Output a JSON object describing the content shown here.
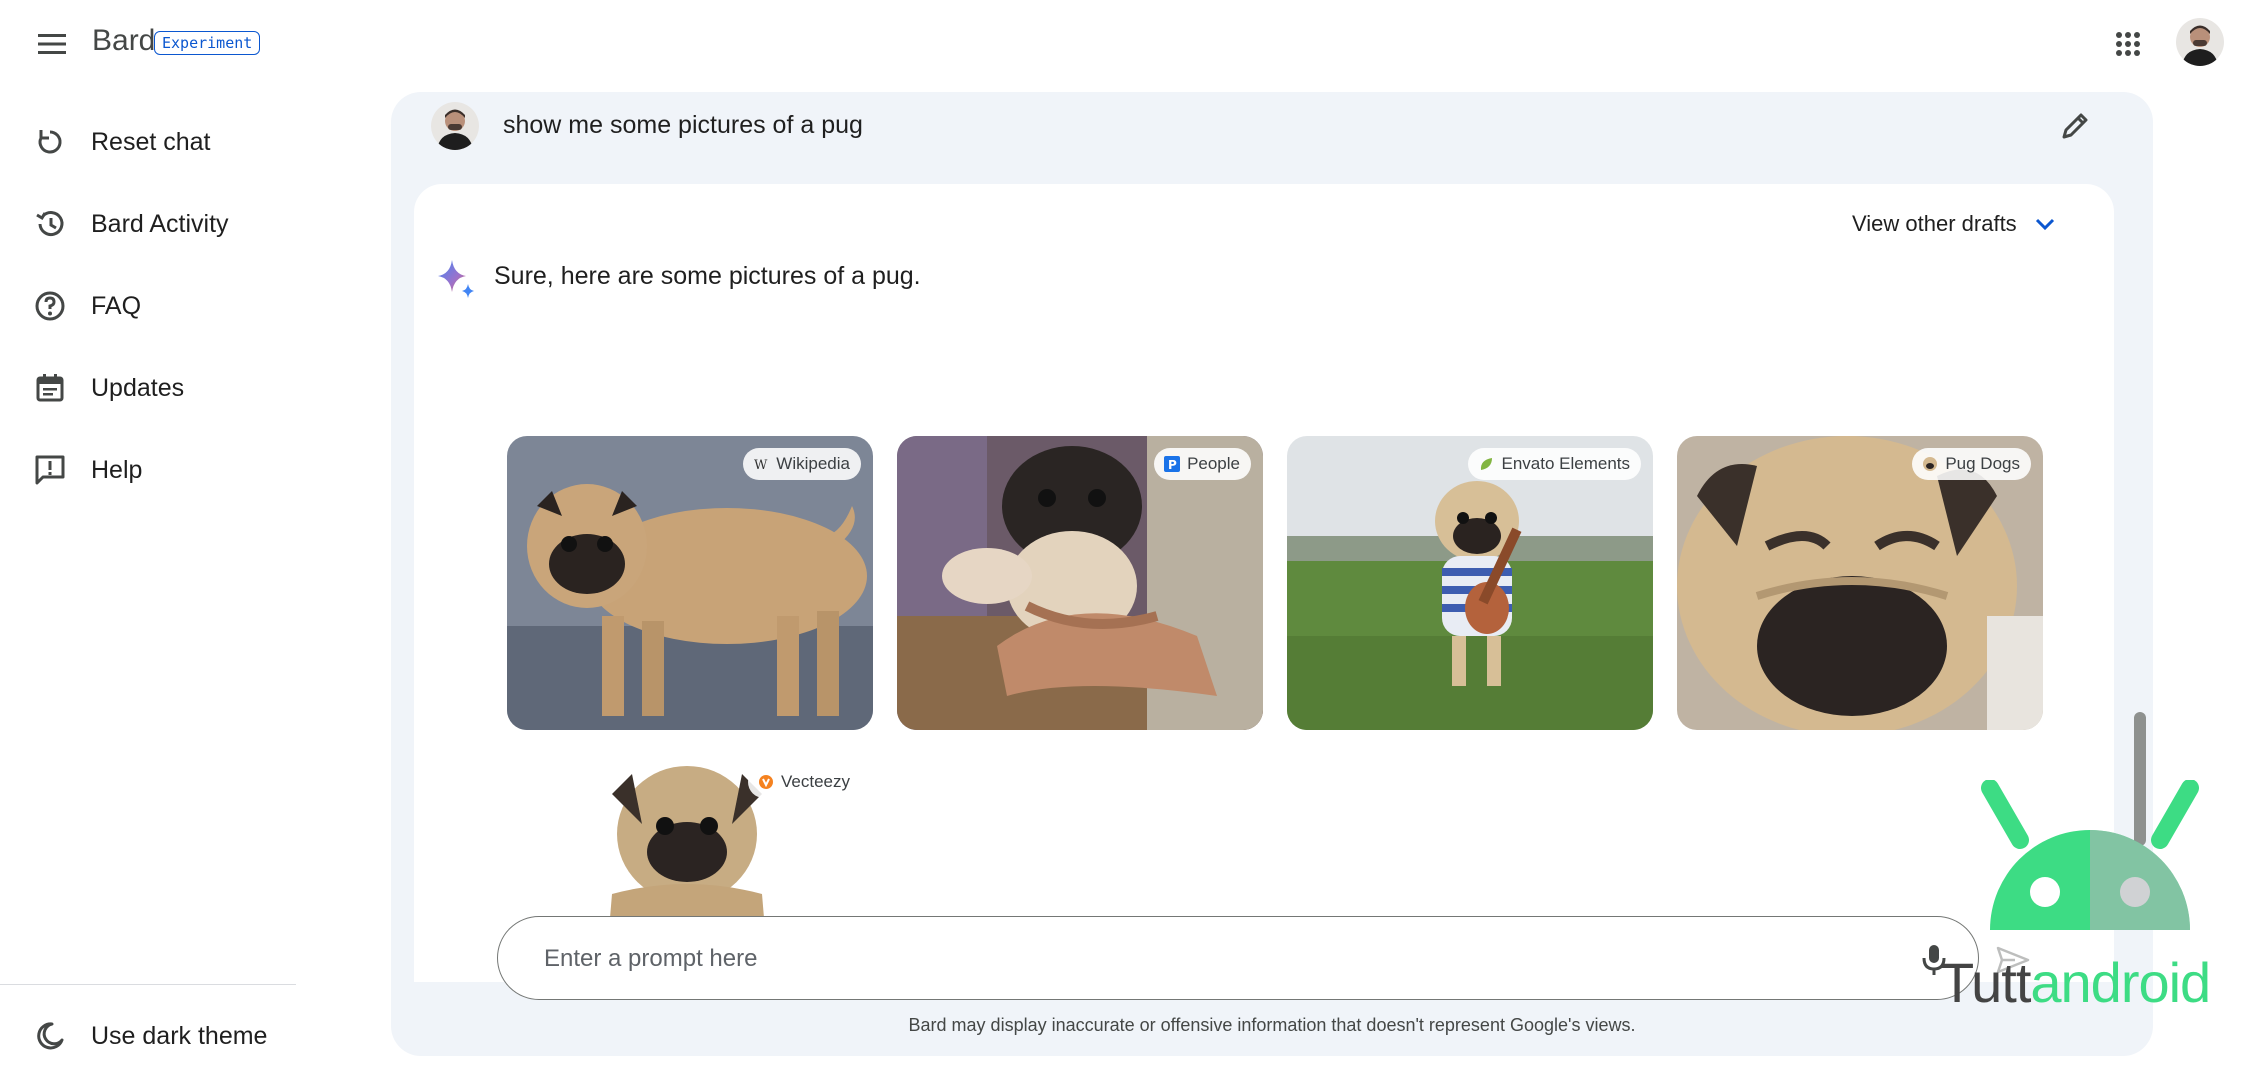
{
  "app": {
    "name": "Bard",
    "badge": "Experiment"
  },
  "header": {
    "menu_icon": "hamburger-menu-icon",
    "apps_icon": "apps-grid-icon"
  },
  "sidebar": {
    "items": [
      {
        "label": "Reset chat",
        "icon": "reset-icon"
      },
      {
        "label": "Bard Activity",
        "icon": "history-icon"
      },
      {
        "label": "FAQ",
        "icon": "help-circle-icon"
      },
      {
        "label": "Updates",
        "icon": "calendar-icon"
      },
      {
        "label": "Help",
        "icon": "feedback-icon"
      }
    ],
    "footer": {
      "label": "Use dark theme",
      "icon": "moon-icon"
    }
  },
  "conversation": {
    "user_query": "show me some pictures of a pug",
    "drafts_label": "View other drafts",
    "response_text": "Sure, here are some pictures of a pug.",
    "images": [
      {
        "source": "Wikipedia"
      },
      {
        "source": "People"
      },
      {
        "source": "Envato Elements"
      },
      {
        "source": "Pug Dogs"
      },
      {
        "source": "Vecteezy"
      }
    ]
  },
  "input": {
    "placeholder": "Enter a prompt here",
    "value": ""
  },
  "disclaimer": "Bard may display inaccurate or offensive information that doesn't represent Google's views.",
  "watermark": {
    "part1": "Tutt",
    "part2": "android"
  },
  "colors": {
    "panel_bg": "#f0f4f9",
    "accent": "#0b57d0",
    "android_green": "#3ddc84"
  }
}
